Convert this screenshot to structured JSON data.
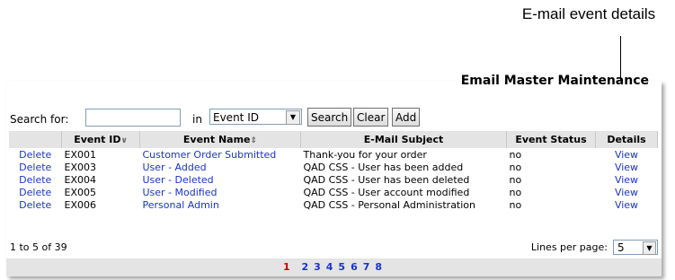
{
  "callout": "E-mail event details",
  "title": "Email Master Maintenance",
  "search": {
    "label": "Search for:",
    "in_label": "in",
    "value": "",
    "field": "Event ID",
    "buttons": [
      "Search",
      "Clear",
      "Add"
    ]
  },
  "table": {
    "headers": [
      "",
      "Event ID",
      "Event Name",
      "E-Mail Subject",
      "Event Status",
      "Details"
    ],
    "rows": [
      [
        "Delete",
        "EX001",
        "Customer Order Submitted",
        "Thank-you for your order",
        "no",
        "View"
      ],
      [
        "Delete",
        "EX003",
        "User - Added",
        "QAD CSS - User has been added",
        "no",
        "View"
      ],
      [
        "Delete",
        "EX004",
        "User - Deleted",
        "QAD CSS - User has been deleted",
        "no",
        "View"
      ],
      [
        "Delete",
        "EX005",
        "User - Modified",
        "QAD CSS - User account modified",
        "no",
        "View"
      ],
      [
        "Delete",
        "EX006",
        "Personal Admin",
        "QAD CSS - Personal Administration",
        "no",
        "View"
      ]
    ]
  },
  "footer": {
    "range": "1 to 5 of 39",
    "lines_label": "Lines per page:",
    "lines_value": "5"
  },
  "pager": {
    "current": "1",
    "pages": [
      "2",
      "3",
      "4",
      "5",
      "6",
      "7",
      "8"
    ]
  },
  "colors": {
    "link": "#1a33cc",
    "current_page": "#cc0000",
    "header_bg": "#e4e4e4"
  }
}
